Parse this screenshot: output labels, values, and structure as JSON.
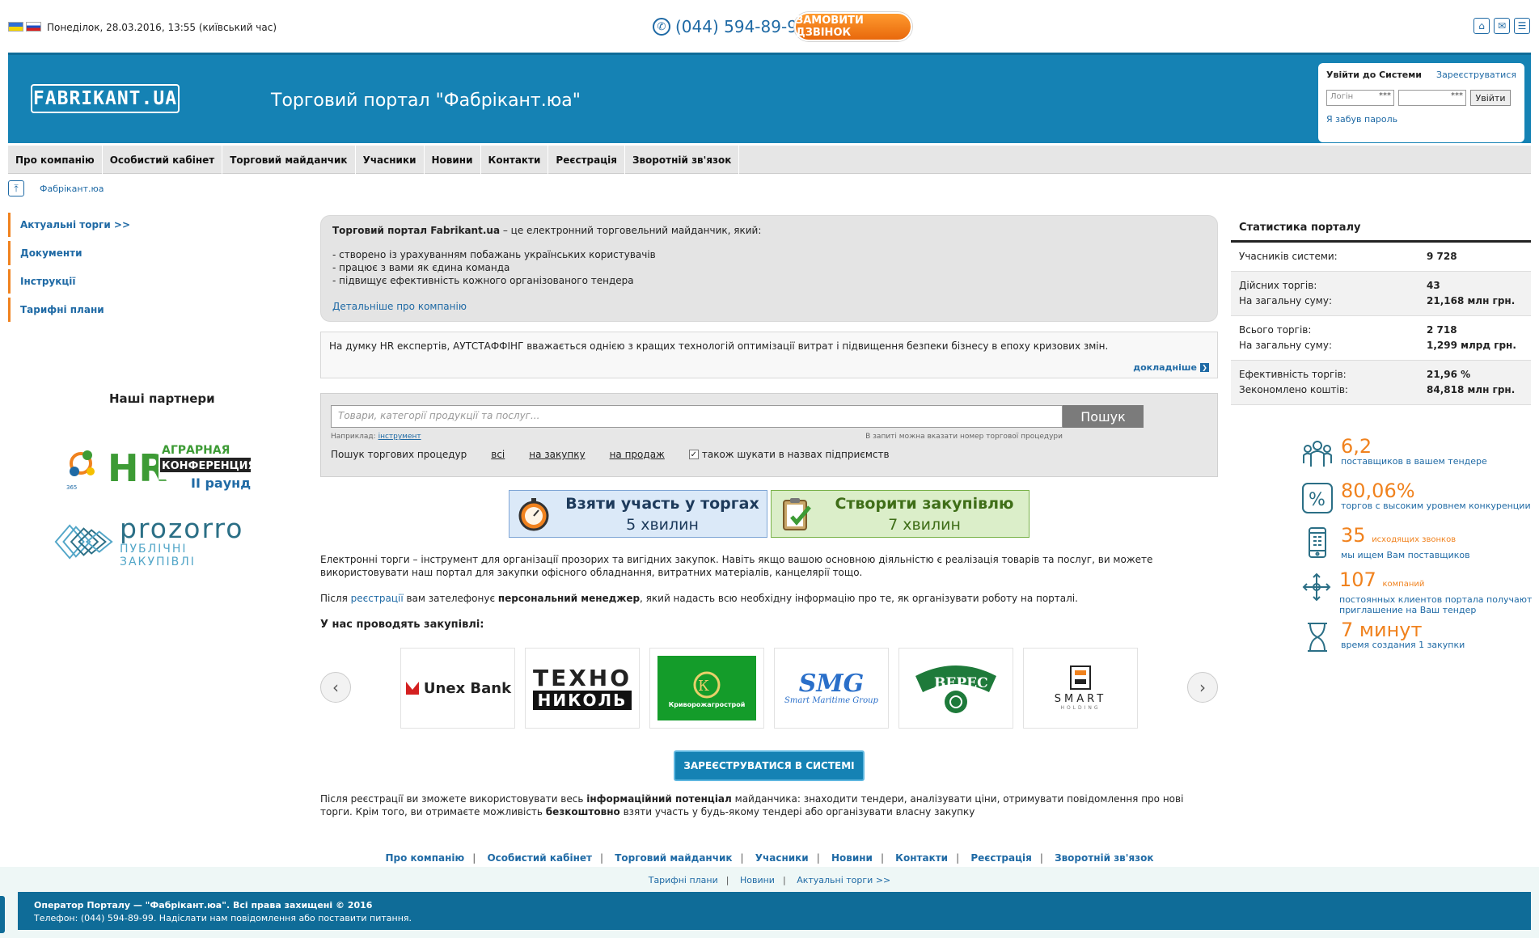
{
  "top": {
    "datetime": "Понеділок, 28.03.2016, 13:55 (київський час)",
    "phone": "(044) 594-89-99",
    "callback_label": "ЗАМОВИТИ ДЗВІНОК"
  },
  "header": {
    "logo": "FABRIKANT.UA",
    "title": "Торговий портал \"Фабрікант.юа\""
  },
  "login": {
    "title": "Увійти до Системи",
    "register": "Зареєструватися",
    "login_placeholder": "Логін",
    "stars": "***",
    "submit": "Увійти",
    "forgot": "Я забув пароль"
  },
  "nav": [
    "Про компанію",
    "Особистий кабінет",
    "Торговий майданчик",
    "Учасники",
    "Новини",
    "Контакти",
    "Реєстрація",
    "Зворотній зв'язок"
  ],
  "breadcrumb": "Фабрікант.юа",
  "leftmenu": [
    "Актуальні торги >>",
    "Документи",
    "Інструкції",
    "Тарифні плани"
  ],
  "partners": {
    "title": "Наші партнери",
    "hr_lines": [
      "HR",
      "АГРАРНАЯ",
      "КОНФЕРЕНЦИЯ",
      "II раунд"
    ],
    "prozorro_word": "prozorro",
    "prozorro_sub": "ПУБЛІЧНІ ЗАКУПІВЛІ"
  },
  "intro": {
    "lead_bold": "Торговий портал Fabrikant.ua",
    "lead_rest": " – це електронний торговельний майданчик, який:",
    "items": [
      "- створено із урахуванням побажань українських користувачів",
      "- працює з вами як єдина команда",
      "- підвищує ефективність кожного організованого тендера"
    ],
    "more": "Детальніше про компанію"
  },
  "news": {
    "text": "На думку HR експертів, АУТСТАФФІНГ вважається однією з кращих технологій оптимізації витрат і підвищення безпеки бізнесу в епоху кризових змін.",
    "more": "докладніше"
  },
  "search": {
    "placeholder": "Товари, категорії продукції та послуг...",
    "button": "Пошук",
    "example_label": "Наприклад:",
    "example_link": "інструмент",
    "hint_right": "В запиті можна вказати номер торгової процедури",
    "opts_label": "Пошук торгових процедур",
    "opt_all": "всі",
    "opt_buy": "на закупку",
    "opt_sell": "на продаж",
    "chk_label": "також шукати в назвах підприємств",
    "chk_mark": "✓"
  },
  "cta": [
    {
      "title": "Взяти участь у торгах",
      "sub": "5 хвилин"
    },
    {
      "title": "Створити закупівлю",
      "sub": "7 хвилин"
    }
  ],
  "para1": "Електронні торги – інструмент для організації прозорих та вигідних закупок. Навіть якщо вашою основною діяльністю є реалізація товарів та послуг, ви можете використовувати наш портал для закупки офісного обладнання, витратних матеріалів, канцелярії тощо.",
  "para2": {
    "a": "Після ",
    "link": "реєстрації",
    "b": " вам зателефонує ",
    "bold": "персональний менеджер",
    "c": ", який надасть всю необхідну інформацію про те, як організувати роботу на порталі."
  },
  "logos_title": "У нас проводять закупівлі:",
  "logos": {
    "unex": "Unex Bank",
    "texno1": "ТЕХНО",
    "texno2": "НИКОЛЬ",
    "kryvbas": "Криворожагрострой",
    "smg": "SMG",
    "smg_sub": "Smart Maritime Group",
    "veres": "ВЕРЕС",
    "smart": "SMART",
    "smart_sub": "HOLDING"
  },
  "register_btn": "ЗАРЕЄСТРУВАТИСЯ В СИСТЕМІ",
  "para3": {
    "a": "Після реєстрації ви зможете використовувати весь ",
    "bold1": "інформаційний потенціал",
    "b": " майданчика: знаходити тендери, аналізувати ціни, отримувати повідомлення про нові торги. Крім того, ви отримаєте можливість ",
    "bold2": "безкоштовно",
    "c": " взяти участь у будь-якому тендері або організувати власну закупку"
  },
  "stats": {
    "title": "Статистика порталу",
    "rows": [
      {
        "k": [
          "Учасників системи:"
        ],
        "v": [
          "9 728"
        ]
      },
      {
        "k": [
          "Дійсних торгів:",
          "На загальну суму:"
        ],
        "v": [
          "43",
          "21,168 млн грн."
        ]
      },
      {
        "k": [
          "Всього торгів:",
          "На загальну суму:"
        ],
        "v": [
          "2 718",
          "1,299 млрд грн."
        ]
      },
      {
        "k": [
          "Ефективність торгів:",
          "Зекономлено коштів:"
        ],
        "v": [
          "21,96 %",
          "84,818 млн грн."
        ]
      }
    ]
  },
  "infographic": [
    {
      "num": "6,2",
      "small": "",
      "txt": "поставщиков в вашем тендере"
    },
    {
      "num": "80,06%",
      "small": "",
      "txt": "торгов с высоким уровнем конкуренции"
    },
    {
      "num": "35",
      "small": "исходящих звонков",
      "txt": "мы ищем Вам поставщиков"
    },
    {
      "num": "107",
      "small": "компаний",
      "txt": "постоянных клиентов портала получают приглашение на Ваш тендер"
    },
    {
      "num": "7 минут",
      "small": "",
      "txt": "время создания 1 закупки"
    }
  ],
  "footer": {
    "nav": [
      "Про компанію",
      "Особистий кабінет",
      "Торговий майданчик",
      "Учасники",
      "Новини",
      "Контакти",
      "Реєстрація",
      "Зворотній зв'язок"
    ],
    "nav2": [
      "Тарифні плани",
      "Новини",
      "Актуальні торги >>"
    ],
    "copy": "Оператор Порталу — \"Фабрікант.юа\". Всі права захищені © 2016",
    "contact": "Телефон: (044) 594-89-99. Надіслати нам повідомлення або поставити питання."
  },
  "colors": {
    "brand": "#1582b4",
    "accent": "#f0821e",
    "link": "#1f6aa5"
  }
}
